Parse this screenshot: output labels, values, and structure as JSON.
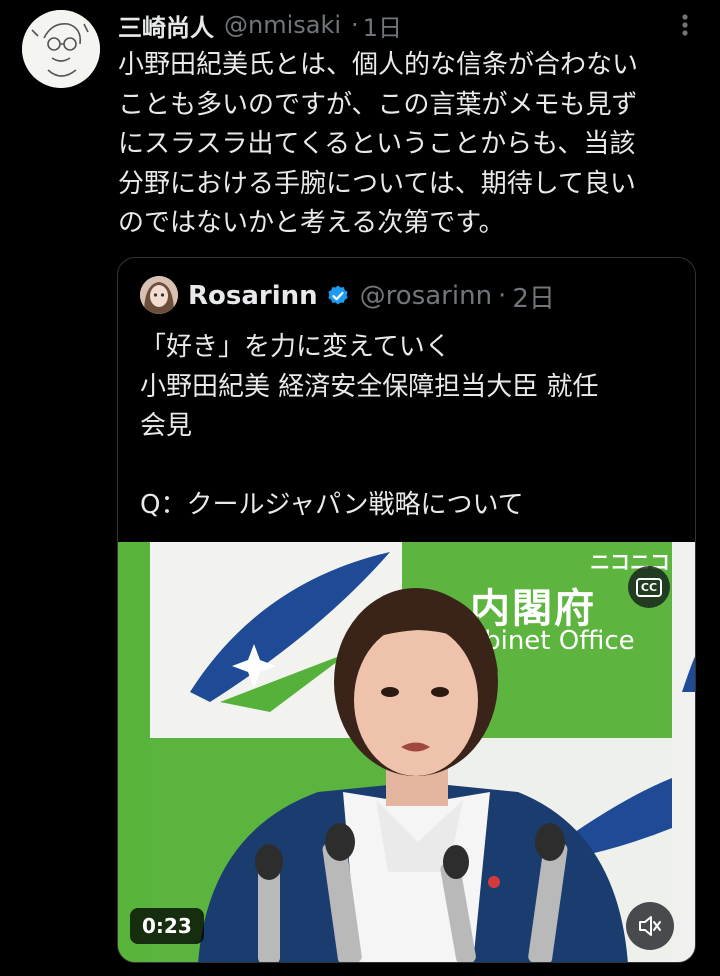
{
  "tweet": {
    "author_name": "三崎尚人",
    "author_handle": "@nmisaki",
    "time": "1日",
    "text": "小野田紀美氏とは、個人的な信条が合わない\nことも多いのですが、この言葉がメモも見ず\nにスラスラ出てくるということからも、当該\n分野における手腕については、期待して良い\nのではないかと考える次第です。"
  },
  "quote": {
    "author_name": "Rosarinn",
    "author_handle": "@rosarinn",
    "time": "2日",
    "text": "「好き」を力に変えていく\n小野田紀美 経済安全保障担当大臣 就任\n会見\n\nQ：クールジャパン戦略について",
    "verified_color": "#1d9bf0"
  },
  "video": {
    "sign_jp": "内閣府",
    "sign_en": "Cabinet Office",
    "watermark": "ニコニコ",
    "cc_label": "CC",
    "duration": "0:23"
  },
  "icons": [
    "more-icon",
    "verified-badge-icon",
    "cc-icon",
    "mute-icon"
  ]
}
